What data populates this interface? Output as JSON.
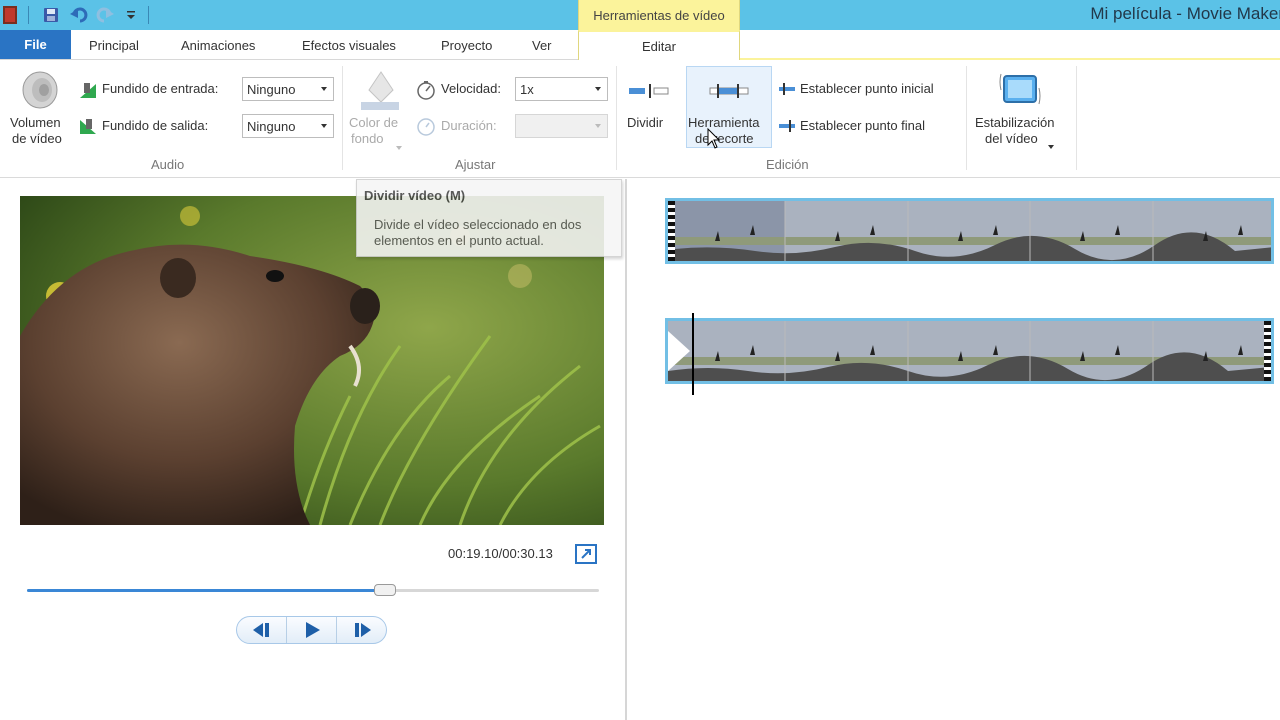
{
  "window_title": "Mi película - Movie Maker",
  "contextual_tab_group": "Herramientas de vídeo",
  "tabs": {
    "file": "File",
    "items": [
      "Principal",
      "Animaciones",
      "Efectos visuales",
      "Proyecto",
      "Ver"
    ],
    "active": "Editar"
  },
  "ribbon": {
    "audio": {
      "group_label": "Audio",
      "volume_label_1": "Volumen",
      "volume_label_2": "de vídeo",
      "fade_in_label": "Fundido de entrada:",
      "fade_in_value": "Ninguno",
      "fade_out_label": "Fundido de salida:",
      "fade_out_value": "Ninguno"
    },
    "ajustar": {
      "group_label": "Ajustar",
      "bg_color_label_1": "Color de",
      "bg_color_label_2": "fondo",
      "speed_label": "Velocidad:",
      "speed_value": "1x",
      "duration_label": "Duración:",
      "duration_value": ""
    },
    "edicion": {
      "group_label": "Edición",
      "split_label": "Dividir",
      "trim_label_1": "Herramienta",
      "trim_label_2": "de recorte",
      "set_start": "Establecer punto inicial",
      "set_end": "Establecer punto final"
    },
    "stabilization": {
      "label_1": "Estabilización",
      "label_2": "del vídeo"
    }
  },
  "tooltip": {
    "title": "Dividir vídeo (M)",
    "description": "Divide el vídeo seleccionado en dos elementos en el punto actual."
  },
  "preview": {
    "time": "00:19.10/00:30.13",
    "progress_fraction": 0.634
  },
  "colors": {
    "titlebar": "#5bc2e7",
    "file_tab": "#2a74c4",
    "contextual": "#fbf39b",
    "clip_border": "#72bfe5",
    "seek_fill": "#3a87d6"
  }
}
